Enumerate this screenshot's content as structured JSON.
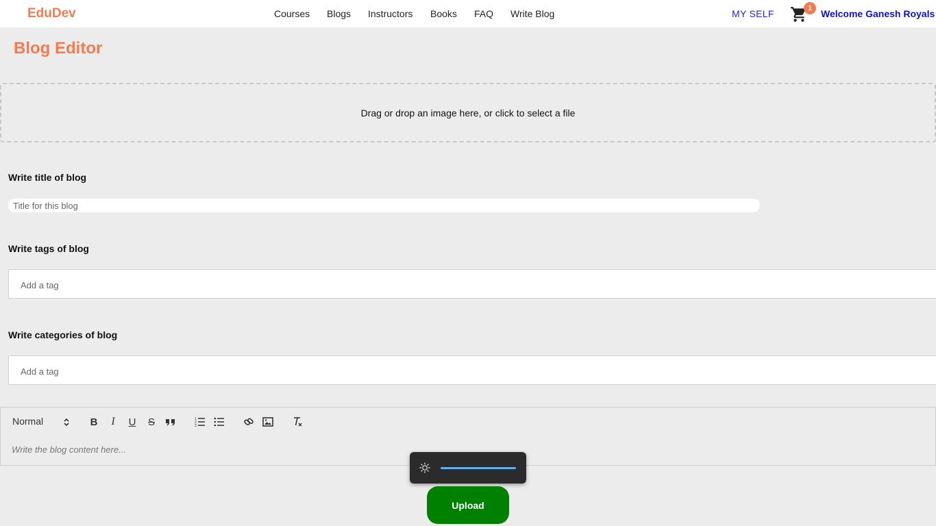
{
  "header": {
    "brand": "EduDev",
    "nav": [
      "Courses",
      "Blogs",
      "Instructors",
      "Books",
      "FAQ",
      "Write Blog"
    ],
    "my_self": "MY SELF",
    "cart_count": "1",
    "cart_icon": "shopping-cart-icon",
    "welcome": "Welcome Ganesh Royals"
  },
  "page": {
    "title": "Blog Editor"
  },
  "dropzone": {
    "text": "Drag or drop an image here, or click to select a file"
  },
  "form": {
    "title_label": "Write title of blog",
    "title_placeholder": "Title for this blog",
    "tags_label": "Write tags of blog",
    "tags_placeholder": "Add a tag",
    "categories_label": "Write categories of blog",
    "categories_placeholder": "Add a tag"
  },
  "editor": {
    "format_selected": "Normal",
    "toolbar_icons": [
      "bold-icon",
      "italic-icon",
      "underline-icon",
      "strike-icon",
      "blockquote-icon",
      "ordered-list-icon",
      "bullet-list-icon",
      "link-icon",
      "image-icon",
      "clean-format-icon"
    ],
    "bold_glyph": "B",
    "italic_glyph": "I",
    "underline_glyph": "U",
    "strike_glyph": "S",
    "placeholder": "Write the blog content here..."
  },
  "brightness_popup": {
    "icon": "brightness-icon",
    "level": 1.0
  },
  "actions": {
    "upload_label": "Upload"
  },
  "colors": {
    "accent": "#f27b4f",
    "link_blue": "#2626c8",
    "upload_green": "#008000",
    "background": "#ececec"
  }
}
